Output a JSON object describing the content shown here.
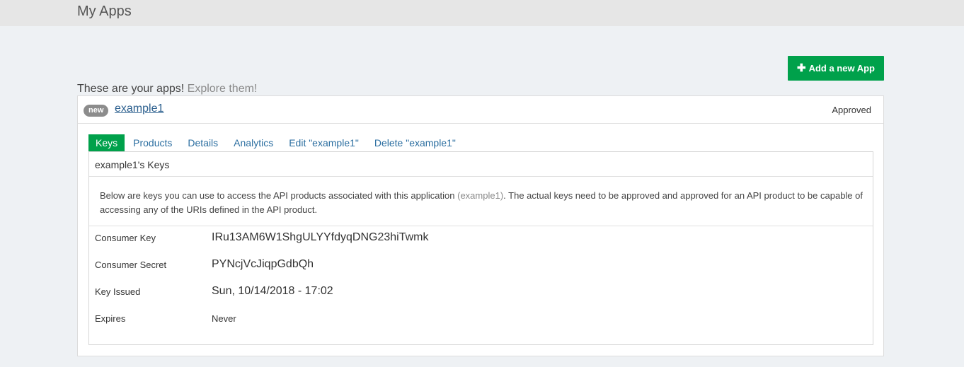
{
  "header": {
    "title": "My Apps"
  },
  "actions": {
    "add_app_label": "Add a new App"
  },
  "intro": {
    "text": "These are your apps!",
    "link": "Explore them!"
  },
  "app": {
    "badge": "new",
    "name": "example1",
    "status": "Approved",
    "tabs": [
      {
        "label": "Keys",
        "active": true
      },
      {
        "label": "Products"
      },
      {
        "label": "Details"
      },
      {
        "label": "Analytics"
      },
      {
        "label": "Edit \"example1\""
      },
      {
        "label": "Delete \"example1\""
      }
    ],
    "keys": {
      "title": "example1's Keys",
      "desc_before": "Below are keys you can use to access the API products associated with this application",
      "desc_app": "(example1)",
      "desc_after": ". The actual keys need to be approved and approved for an API product to be capable of accessing any of the URIs defined in the API product.",
      "rows": [
        {
          "label": "Consumer Key",
          "value": "IRu13AM6W1ShgULYYfdyqDNG23hiTwmk"
        },
        {
          "label": "Consumer Secret",
          "value": "PYNcjVcJiqpGdbQh"
        },
        {
          "label": "Key Issued",
          "value": "Sun, 10/14/2018 - 17:02"
        },
        {
          "label": "Expires",
          "value": "Never"
        }
      ]
    }
  }
}
